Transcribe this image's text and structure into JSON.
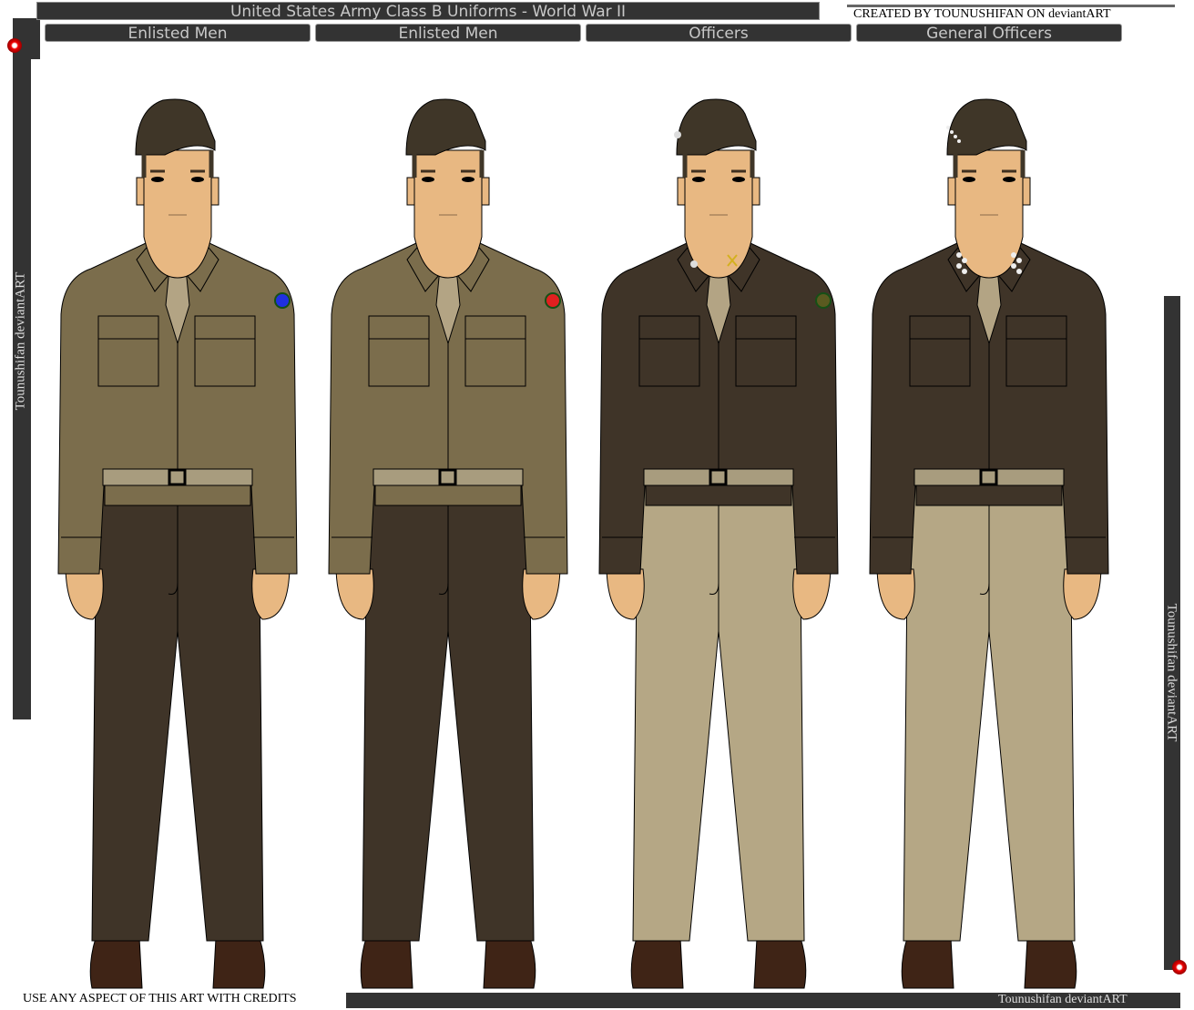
{
  "header": {
    "title": "United States Army Class B Uniforms - World War II",
    "credit": "CREATED BY TOUNUSHIFAN ON deviantART"
  },
  "tabs": [
    {
      "label": "Enlisted Men"
    },
    {
      "label": "Enlisted Men"
    },
    {
      "label": "Officers"
    },
    {
      "label": "General Officers"
    }
  ],
  "side_left": "Tounushifan deviantART",
  "side_right": "Tounushifan deviantART",
  "footer": {
    "left": "USE ANY ASPECT OF THIS ART WITH CREDITS",
    "right": "Tounushifan deviantART"
  },
  "colors": {
    "frame": "#333333",
    "skin": "#e8b882",
    "hat": "#3f3628",
    "tie": "#b3a484",
    "boots": "#3f2416"
  },
  "figures": [
    {
      "shirt": "#7b6d4c",
      "trousers": "#3f3428",
      "patch": "#2030e0",
      "insignia": "none"
    },
    {
      "shirt": "#7b6d4c",
      "trousers": "#3f3428",
      "patch": "#e02020",
      "insignia": "none"
    },
    {
      "shirt": "#3f3428",
      "trousers": "#b5a785",
      "patch": "#5a5a20",
      "insignia": "officer"
    },
    {
      "shirt": "#3f3428",
      "trousers": "#b5a785",
      "patch": "none",
      "insignia": "general"
    }
  ]
}
